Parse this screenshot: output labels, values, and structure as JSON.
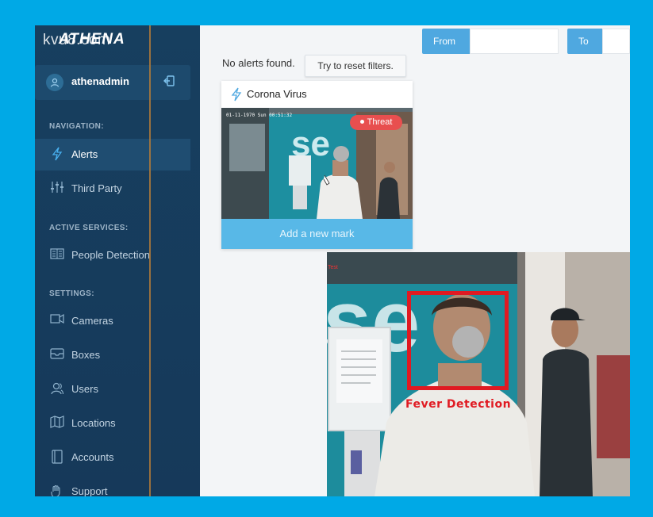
{
  "sidebar": {
    "brand_url": "kvu8.com",
    "brand_name": "ATHENA",
    "user": {
      "name": "athenadmin",
      "avatar_icon": "user-icon",
      "logout_icon": "logout-icon"
    },
    "sections": {
      "navigation": "NAVIGATION:",
      "active_services": "ACTIVE SERVICES:",
      "settings": "SETTINGS:"
    },
    "nav_items": [
      {
        "label": "Alerts",
        "icon": "bolt-icon",
        "active": true
      },
      {
        "label": "Third Party",
        "icon": "sliders-icon",
        "active": false
      }
    ],
    "service_items": [
      {
        "label": "People Detection",
        "icon": "book-icon"
      }
    ],
    "settings_items": [
      {
        "label": "Cameras",
        "icon": "camera-icon"
      },
      {
        "label": "Boxes",
        "icon": "box-icon"
      },
      {
        "label": "Users",
        "icon": "users-icon"
      },
      {
        "label": "Locations",
        "icon": "map-icon"
      },
      {
        "label": "Accounts",
        "icon": "account-icon"
      },
      {
        "label": "Support",
        "icon": "support-icon"
      }
    ]
  },
  "topbar": {
    "from_label": "From",
    "to_label": "To"
  },
  "alerts": {
    "empty_message": "No alerts found.",
    "reset_label": "Try to reset filters."
  },
  "card": {
    "title": "Corona Virus",
    "timestamp": "01-11-1970 Sun 00:51:32",
    "threat_label": "Threat",
    "add_mark_label": "Add a new mark"
  },
  "video": {
    "detection_label": "Fever Detection",
    "corner_text": "Test"
  },
  "colors": {
    "frame": "#00a9e6",
    "sidebar": "#173f5f",
    "accent": "#4fa8e0",
    "threat": "#e84f4f",
    "fever": "#e01a22"
  }
}
